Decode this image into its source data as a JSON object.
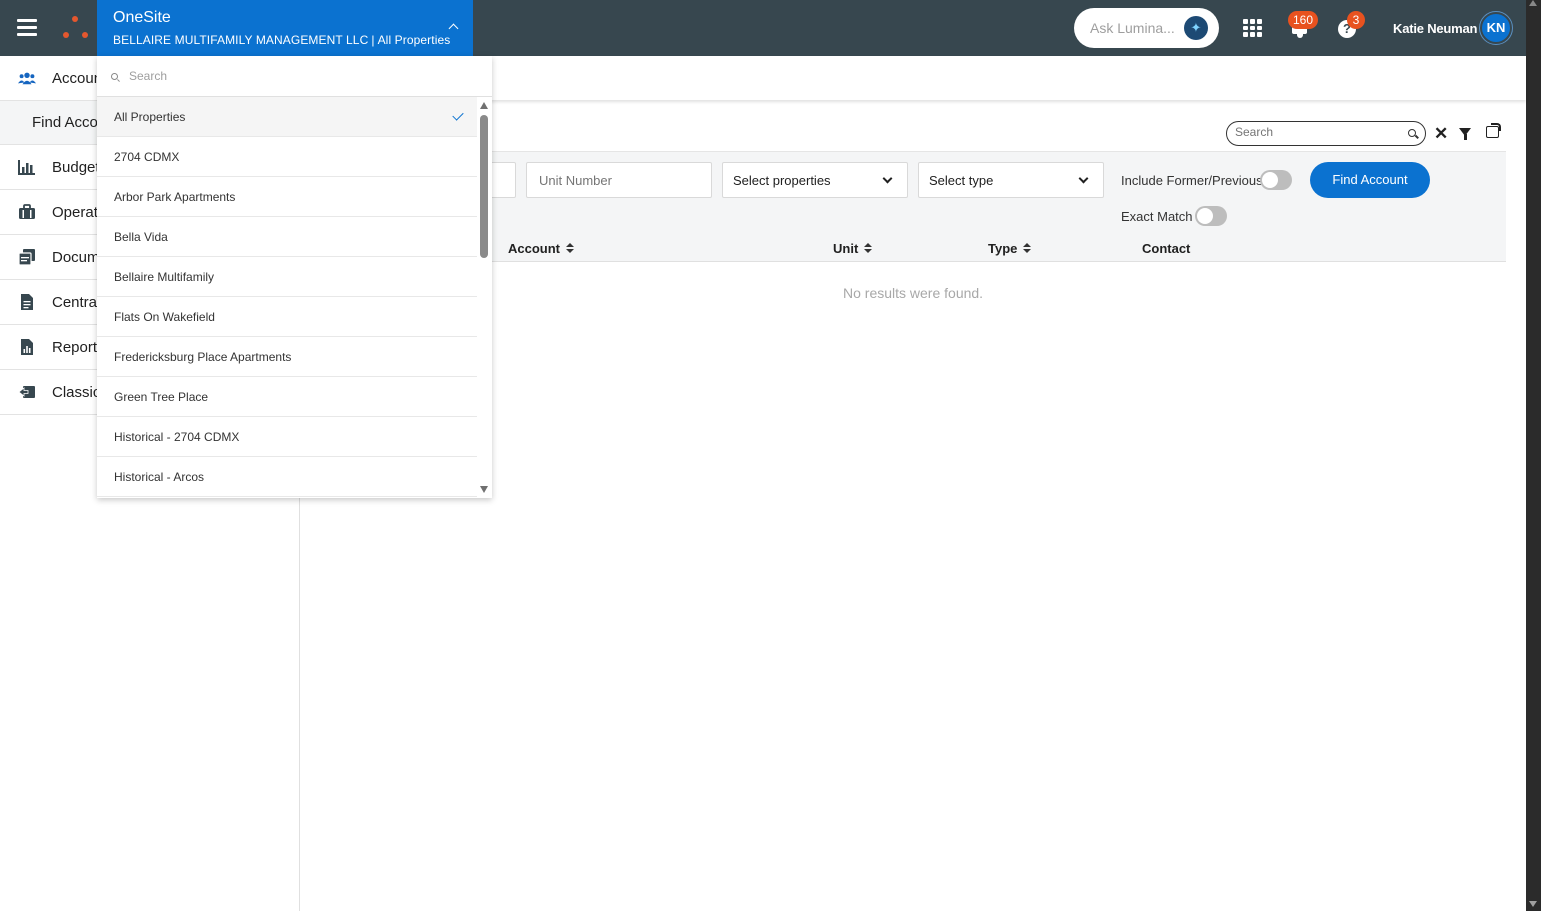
{
  "app": {
    "name": "OneSite",
    "company": "BELLAIRE MULTIFAMILY MANAGEMENT LLC",
    "separator": "|",
    "scope": "All Properties"
  },
  "header": {
    "lumina_placeholder": "Ask Lumina...",
    "notifications_count": "160",
    "help_count": "3",
    "user_name": "Katie Neuman",
    "user_initials": "KN"
  },
  "sidebar": {
    "items": [
      {
        "label": "Accounts",
        "icon": "people-icon"
      },
      {
        "label": "Budget",
        "icon": "bar-chart-icon"
      },
      {
        "label": "Operations",
        "icon": "briefcase-icon"
      },
      {
        "label": "Documents",
        "icon": "documents-icon"
      },
      {
        "label": "Central",
        "icon": "file-icon"
      },
      {
        "label": "Reporting",
        "icon": "report-icon"
      },
      {
        "label": "Classic",
        "icon": "classic-icon"
      }
    ],
    "sub_item": "Find Account"
  },
  "toolbar": {
    "search_placeholder": "Search"
  },
  "filters": {
    "unit_number_placeholder": "Unit Number",
    "properties_select": "Select properties",
    "type_select": "Select type",
    "include_former_label": "Include Former/Previous",
    "exact_match_label": "Exact Match",
    "find_button": "Find Account"
  },
  "table": {
    "columns": [
      "Account",
      "Unit",
      "Type",
      "Contact"
    ],
    "empty_message": "No results were found."
  },
  "dropdown": {
    "search_placeholder": "Search",
    "options": [
      "All Properties",
      "2704 CDMX",
      "Arbor Park Apartments",
      "Bella Vida",
      "Bellaire Multifamily",
      "Flats On Wakefield",
      "Fredericksburg Place Apartments",
      "Green Tree Place",
      "Historical - 2704 CDMX",
      "Historical - Arcos"
    ],
    "selected": "All Properties"
  },
  "colors": {
    "topbar": "#37474f",
    "accent": "#0b72d0",
    "badge": "#e8521f",
    "logo": "#e4572e"
  }
}
